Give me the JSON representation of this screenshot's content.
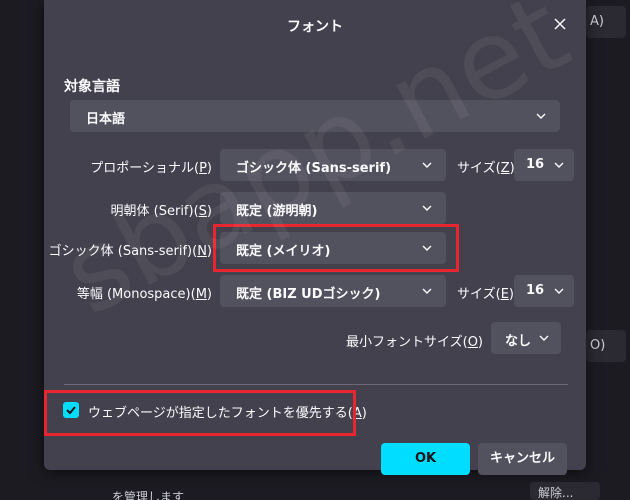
{
  "dialog": {
    "title": "フォント",
    "section_title": "対象言語",
    "language_select": "日本語",
    "rows": {
      "proportional": {
        "label_pre": "プロポーショナル(",
        "key": "P",
        "label_post": ")",
        "value": "ゴシック体 (Sans-serif)"
      },
      "serif": {
        "label_pre": "明朝体 (Serif)(",
        "key": "S",
        "label_post": ")",
        "value": "既定 (游明朝)"
      },
      "sans": {
        "label_pre": "ゴシック体 (Sans-serif)(",
        "key": "N",
        "label_post": ")",
        "value": "既定 (メイリオ)"
      },
      "mono": {
        "label_pre": "等幅 (Monospace)(",
        "key": "M",
        "label_post": ")",
        "value": "既定 (BIZ UDゴシック)"
      }
    },
    "size_prop": {
      "label_pre": "サイズ(",
      "key": "Z",
      "label_post": ")",
      "value": "16"
    },
    "size_mono": {
      "label_pre": "サイズ(",
      "key": "E",
      "label_post": ")",
      "value": "16"
    },
    "min_size": {
      "label_pre": "最小フォントサイズ(",
      "key": "O",
      "label_post": ")",
      "value": "なし"
    },
    "allow_pages": {
      "label_pre": "ウェブページが指定したフォントを優先する(",
      "key": "A",
      "label_post": ")",
      "checked": true
    },
    "ok": "OK",
    "cancel": "キャンセル"
  },
  "background": {
    "frag_top": "A)",
    "frag_mid": "O)",
    "frag_bottom": "を管理します",
    "frag_bottom_right": "解除..."
  },
  "watermark": "sbapp.net",
  "colors": {
    "accent": "#00ddff",
    "highlight": "#e8262f",
    "dialog_bg": "#42414d",
    "field_bg": "#52515e"
  }
}
